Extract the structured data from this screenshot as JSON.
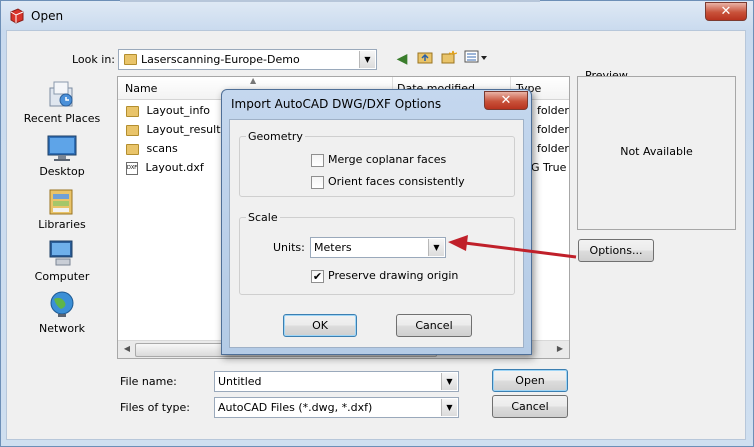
{
  "window": {
    "title": "Open",
    "close_glyph": "✕"
  },
  "toolbar": {
    "look_in_label": "Look in:",
    "look_in_value": "Laserscanning-Europe-Demo",
    "icons": [
      "back-arrow-icon",
      "up-folder-icon",
      "new-folder-icon",
      "view-menu-icon"
    ]
  },
  "places": [
    {
      "label": "Recent Places",
      "icon": "recent-places-icon"
    },
    {
      "label": "Desktop",
      "icon": "desktop-icon"
    },
    {
      "label": "Libraries",
      "icon": "libraries-icon"
    },
    {
      "label": "Computer",
      "icon": "computer-icon"
    },
    {
      "label": "Network",
      "icon": "network-icon"
    }
  ],
  "file_list": {
    "columns": [
      "Name",
      "Date modified",
      "Type"
    ],
    "rows": [
      {
        "name": "Layout_info",
        "type": "folder",
        "icon": "folder-icon"
      },
      {
        "name": "Layout_results",
        "type": "folder",
        "icon": "folder-icon"
      },
      {
        "name": "scans",
        "type": "folder",
        "icon": "folder-icon"
      },
      {
        "name": "Layout.dxf",
        "type": "G True",
        "icon": "dxf-file-icon"
      }
    ]
  },
  "preview": {
    "label": "Preview",
    "status": "Not Available"
  },
  "options_button": "Options...",
  "bottom": {
    "file_name_label": "File name:",
    "file_name_value": "Untitled",
    "file_type_label": "Files of type:",
    "file_type_value": "AutoCAD Files (*.dwg, *.dxf)",
    "open_button": "Open",
    "cancel_button": "Cancel"
  },
  "dialog": {
    "title": "Import AutoCAD DWG/DXF Options",
    "close_glyph": "✕",
    "geometry_group": "Geometry",
    "merge_label": "Merge coplanar faces",
    "merge_checked": false,
    "orient_label": "Orient faces consistently",
    "orient_checked": false,
    "scale_group": "Scale",
    "units_label": "Units:",
    "units_value": "Meters",
    "preserve_label": "Preserve drawing origin",
    "preserve_checked": true,
    "check_glyph": "✔",
    "ok_button": "OK",
    "cancel_button": "Cancel"
  },
  "annotation": {
    "arrow_color": "#c0202a"
  },
  "colors": {
    "accent_border": "#3c7fb1",
    "title_bar": "#c9daee",
    "close_red": "#c8523a"
  }
}
